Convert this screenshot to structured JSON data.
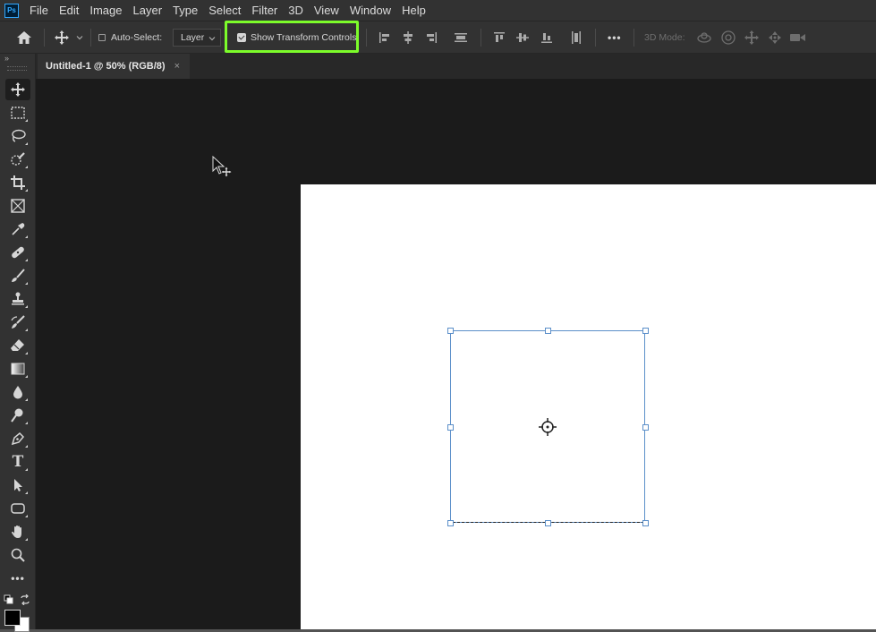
{
  "app": {
    "logo": "Ps"
  },
  "menu": [
    "File",
    "Edit",
    "Image",
    "Layer",
    "Type",
    "Select",
    "Filter",
    "3D",
    "View",
    "Window",
    "Help"
  ],
  "options": {
    "auto_select_label": "Auto-Select:",
    "auto_select_checked": false,
    "target_dropdown": "Layer",
    "show_transform_label": "Show Transform Controls",
    "show_transform_checked": true,
    "mode_3d_label": "3D Mode:",
    "more_label": "•••"
  },
  "document_tab": {
    "title": "Untitled-1 @ 50% (RGB/8)",
    "close": "×"
  },
  "toolbar": {
    "collapse": "»",
    "tools": [
      "move-tool",
      "marquee-tool",
      "lasso-tool",
      "quick-selection-tool",
      "crop-tool",
      "frame-tool",
      "eyedropper-tool",
      "healing-brush-tool",
      "brush-tool",
      "clone-stamp-tool",
      "history-brush-tool",
      "eraser-tool",
      "gradient-tool",
      "blur-tool",
      "dodge-tool",
      "pen-tool",
      "type-tool",
      "path-selection-tool",
      "rectangle-tool",
      "hand-tool",
      "zoom-tool",
      "edit-toolbar"
    ],
    "type_glyph": "T",
    "more_glyph": "•••"
  },
  "colors": {
    "foreground": "#000000",
    "background": "#ffffff",
    "highlight": "#7cfc2a",
    "selection": "#5b8fc9"
  }
}
